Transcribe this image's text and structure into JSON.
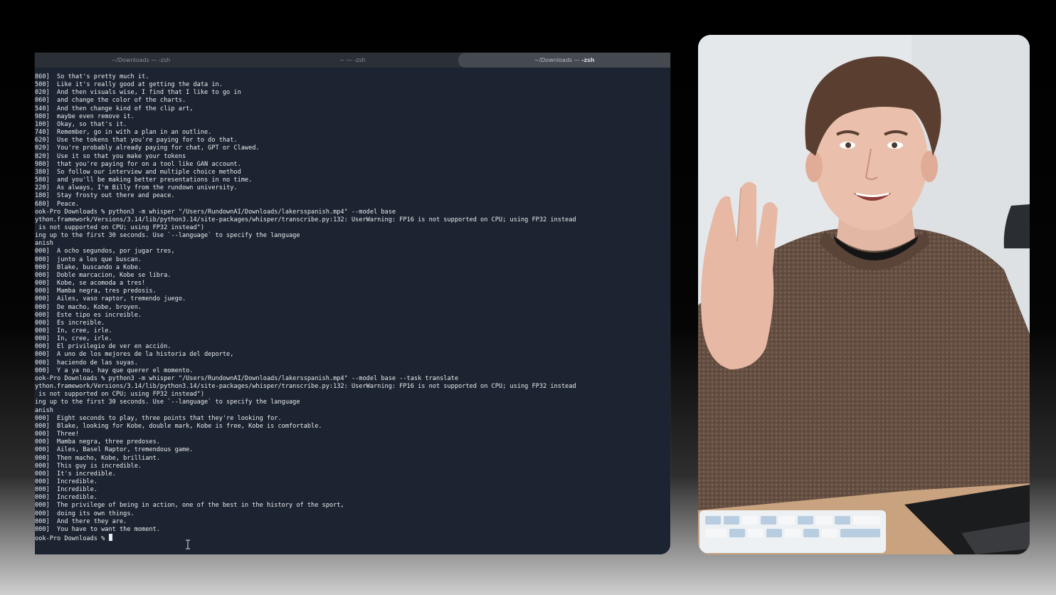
{
  "terminal": {
    "tabs": [
      {
        "label": "~/Downloads — -zsh",
        "active": false
      },
      {
        "label": "~ — -zsh",
        "active": false
      },
      {
        "label_dim": "~/Downloads — ",
        "label_bold": "-zsh",
        "active": true
      }
    ],
    "lines": [
      "860]  So that's pretty much it.",
      "500]  Like it's really good at getting the data in.",
      "020]  And then visuals wise, I find that I like to go in",
      "060]  and change the color of the charts.",
      "540]  And then change kind of the clip art,",
      "980]  maybe even remove it.",
      "100]  Okay, so that's it.",
      "740]  Remember, go in with a plan in an outline.",
      "620]  Use the tokens that you're paying for to do that.",
      "020]  You're probably already paying for chat, GPT or Clawed.",
      "820]  Use it so that you make your tokens",
      "980]  that you're paying for on a tool like GAN account.",
      "380]  So follow our interview and multiple choice method",
      "580]  and you'll be making better presentations in no time.",
      "220]  As always, I'm Billy from the rundown university.",
      "180]  Stay frosty out there and peace.",
      "680]  Peace.",
      "ook-Pro Downloads % python3 -m whisper \"/Users/RundownAI/Downloads/lakersspanish.mp4\" --model base",
      "ython.framework/Versions/3.14/lib/python3.14/site-packages/whisper/transcribe.py:132: UserWarning: FP16 is not supported on CPU; using FP32 instead",
      " is not supported on CPU; using FP32 instead\")",
      "ing up to the first 30 seconds. Use `--language` to specify the language",
      "anish",
      "000]  A ocho segundos, por jugar tres,",
      "000]  junto a los que buscan.",
      "000]  Blake, buscando a Kobe.",
      "000]  Doble marcacion, Kobe se libra.",
      "000]  Kobe, se acomoda a tres!",
      "000]  Mamba negra, tres predosis.",
      "000]  Ailes, vaso raptor, tremendo juego.",
      "000]  De macho, Kobe, broyen.",
      "000]  Este tipo es increible.",
      "000]  Es increible.",
      "000]  In, cree, irle.",
      "000]  In, cree, irle.",
      "000]  El privilegio de ver en acción.",
      "000]  A uno de los mejores de la historia del deporte,",
      "000]  haciendo de las suyas.",
      "000]  Y a ya no, hay que querer el momento.",
      "ook-Pro Downloads % python3 -m whisper \"/Users/RundownAI/Downloads/lakersspanish.mp4\" --model base --task translate",
      "ython.framework/Versions/3.14/lib/python3.14/site-packages/whisper/transcribe.py:132: UserWarning: FP16 is not supported on CPU; using FP32 instead",
      " is not supported on CPU; using FP32 instead\")",
      "ing up to the first 30 seconds. Use `--language` to specify the language",
      "anish",
      "000]  Eight seconds to play, three points that they're looking for.",
      "000]  Blake, looking for Kobe, double mark, Kobe is free, Kobe is comfortable.",
      "000]  Three!",
      "000]  Mamba negra, three predoses.",
      "000]  Ailes, Basel Raptor, tremendous game.",
      "000]  Then macho, Kobe, brilliant.",
      "000]  This guy is incredible.",
      "000]  It's incredible.",
      "000]  Incredible.",
      "000]  Incredible.",
      "000]  Incredible.",
      "000]  The privilege of being in action, one of the best in the history of the sport,",
      "000]  doing its own things.",
      "000]  And there they are.",
      "000]  You have to want the moment."
    ],
    "prompt": "ook-Pro Downloads % "
  },
  "colors": {
    "terminal_bg": "#1d2431",
    "terminal_text": "#e9ecef",
    "tabbar_bg": "#2b2f36",
    "active_tab_bg": "#454950"
  },
  "icons": {
    "text_cursor": "ibeam-cursor-icon"
  }
}
